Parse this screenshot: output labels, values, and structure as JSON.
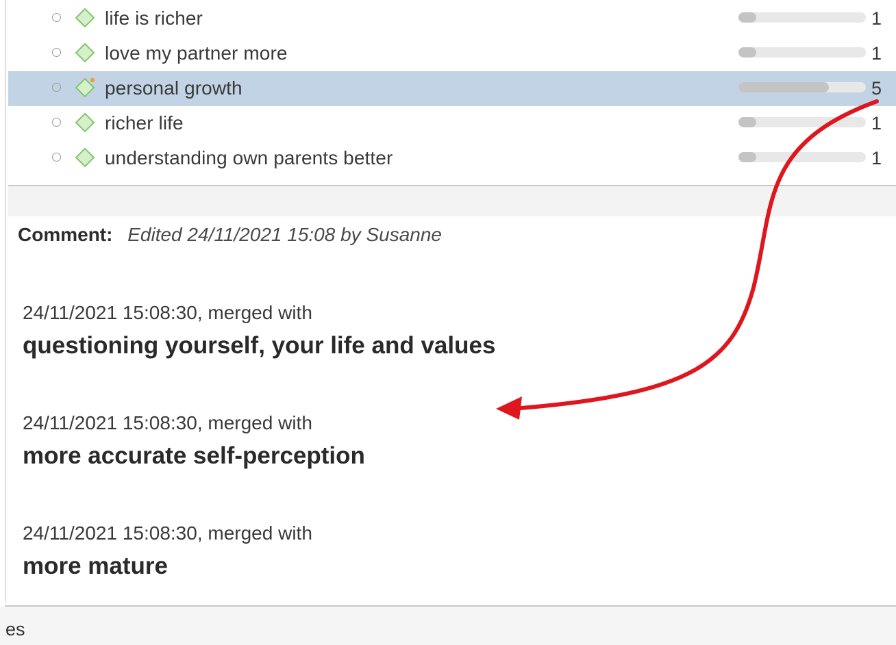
{
  "codes": [
    {
      "label": "life is richer",
      "count": "1",
      "fraction": 0.14,
      "selected": false,
      "memo": false
    },
    {
      "label": "love my partner more",
      "count": "1",
      "fraction": 0.14,
      "selected": false,
      "memo": false
    },
    {
      "label": "personal growth",
      "count": "5",
      "fraction": 0.71,
      "selected": true,
      "memo": true
    },
    {
      "label": "richer life",
      "count": "1",
      "fraction": 0.14,
      "selected": false,
      "memo": false
    },
    {
      "label": "understanding own parents better",
      "count": "1",
      "fraction": 0.14,
      "selected": false,
      "memo": false
    }
  ],
  "comment": {
    "label": "Comment:",
    "meta": "Edited 24/11/2021 15:08 by Susanne"
  },
  "merges": [
    {
      "meta": "24/11/2021 15:08:30, merged with",
      "title": "questioning yourself, your life and values"
    },
    {
      "meta": "24/11/2021 15:08:30, merged with",
      "title": "more accurate self-perception"
    },
    {
      "meta": "24/11/2021 15:08:30, merged with",
      "title": "more mature"
    }
  ],
  "bottom": {
    "text": "es"
  },
  "colors": {
    "selected_row": "#c3d3e6",
    "code_diamond_fill": "#d6f0cc",
    "code_diamond_stroke": "#7fc66b",
    "memo_dot": "#f39b2d",
    "annotation_arrow": "#e0161f"
  },
  "icons": {
    "code": "diamond-code-icon",
    "radio": "radio-circle-icon",
    "memo": "memo-dot-icon"
  }
}
